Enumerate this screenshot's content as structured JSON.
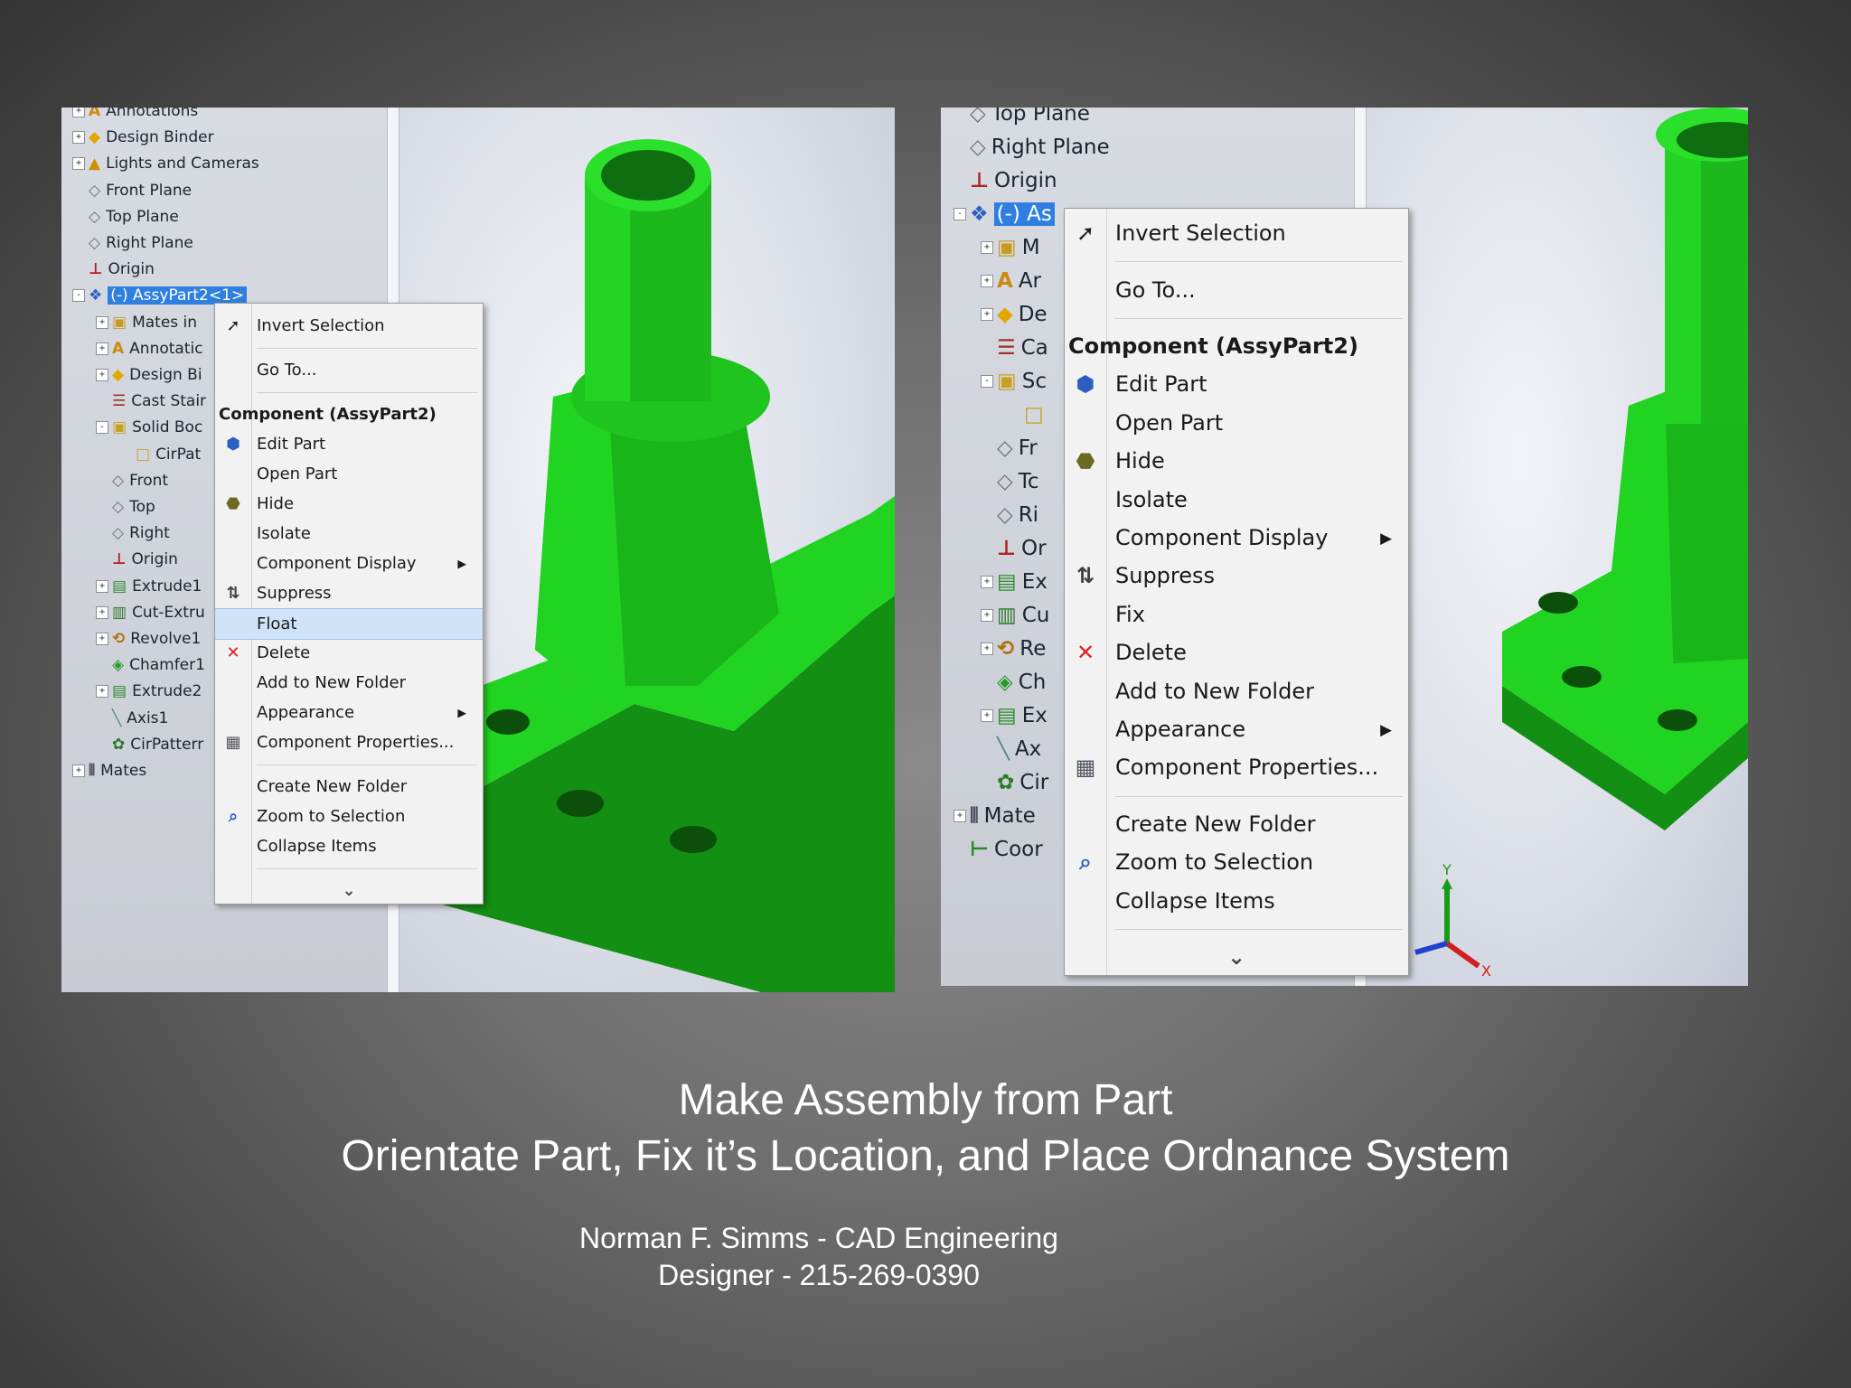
{
  "left_screenshot": {
    "tree": [
      {
        "label": "Annotations",
        "icon": "annotations-icon",
        "exp": "+"
      },
      {
        "label": "Design Binder",
        "icon": "design-binder-icon",
        "exp": "+"
      },
      {
        "label": "Lights and Cameras",
        "icon": "lights-cameras-icon",
        "exp": "+"
      },
      {
        "label": "Front Plane",
        "icon": "plane-icon",
        "exp": ""
      },
      {
        "label": "Top Plane",
        "icon": "plane-icon",
        "exp": ""
      },
      {
        "label": "Right Plane",
        "icon": "plane-icon",
        "exp": ""
      },
      {
        "label": "Origin",
        "icon": "origin-icon",
        "exp": ""
      },
      {
        "label": "(-) AssyPart2<1>",
        "icon": "component-icon",
        "exp": "-",
        "selected": true
      },
      {
        "label": "Mates in",
        "icon": "mates-folder-icon",
        "exp": "+",
        "indent": 1
      },
      {
        "label": "Annotatic",
        "icon": "annotations-icon",
        "exp": "+",
        "indent": 1
      },
      {
        "label": "Design Bi",
        "icon": "design-binder-icon",
        "exp": "+",
        "indent": 1
      },
      {
        "label": "Cast Stair",
        "icon": "cast-stair-icon",
        "exp": "",
        "indent": 1
      },
      {
        "label": "Solid Boc",
        "icon": "solid-bodies-icon",
        "exp": "-",
        "indent": 1
      },
      {
        "label": "CirPat",
        "icon": "body-icon",
        "exp": "",
        "indent": 2
      },
      {
        "label": "Front",
        "icon": "plane-icon",
        "exp": "",
        "indent": 1
      },
      {
        "label": "Top",
        "icon": "plane-icon",
        "exp": "",
        "indent": 1
      },
      {
        "label": "Right",
        "icon": "plane-icon",
        "exp": "",
        "indent": 1
      },
      {
        "label": "Origin",
        "icon": "origin-icon",
        "exp": "",
        "indent": 1
      },
      {
        "label": "Extrude1",
        "icon": "extrude-icon",
        "exp": "+",
        "indent": 1
      },
      {
        "label": "Cut-Extru",
        "icon": "cut-extrude-icon",
        "exp": "+",
        "indent": 1
      },
      {
        "label": "Revolve1",
        "icon": "revolve-icon",
        "exp": "+",
        "indent": 1
      },
      {
        "label": "Chamfer1",
        "icon": "chamfer-icon",
        "exp": "",
        "indent": 1
      },
      {
        "label": "Extrude2",
        "icon": "extrude-icon",
        "exp": "+",
        "indent": 1
      },
      {
        "label": "Axis1",
        "icon": "axis-icon",
        "exp": "",
        "indent": 1
      },
      {
        "label": "CirPatterr",
        "icon": "circular-pattern-icon",
        "exp": "",
        "indent": 1
      },
      {
        "label": "Mates",
        "icon": "mates-icon",
        "exp": "+"
      }
    ],
    "menu": [
      {
        "type": "item",
        "label": "Invert Selection",
        "icon": "invert-selection-icon"
      },
      {
        "type": "sep"
      },
      {
        "type": "item",
        "label": "Go To..."
      },
      {
        "type": "sep"
      },
      {
        "type": "header",
        "label": "Component (AssyPart2)"
      },
      {
        "type": "item",
        "label": "Edit Part",
        "icon": "edit-part-icon"
      },
      {
        "type": "item",
        "label": "Open Part"
      },
      {
        "type": "item",
        "label": "Hide",
        "icon": "hide-icon"
      },
      {
        "type": "item",
        "label": "Isolate"
      },
      {
        "type": "item",
        "label": "Component Display",
        "submenu": true
      },
      {
        "type": "item",
        "label": "Suppress",
        "icon": "suppress-icon"
      },
      {
        "type": "item",
        "label": "Float",
        "highlighted": true
      },
      {
        "type": "item",
        "label": "Delete",
        "icon": "delete-icon"
      },
      {
        "type": "item",
        "label": "Add to New Folder"
      },
      {
        "type": "item",
        "label": "Appearance",
        "submenu": true
      },
      {
        "type": "item",
        "label": "Component Properties...",
        "icon": "component-properties-icon"
      },
      {
        "type": "sep"
      },
      {
        "type": "item",
        "label": "Create New Folder"
      },
      {
        "type": "item",
        "label": "Zoom to Selection",
        "icon": "zoom-to-selection-icon"
      },
      {
        "type": "item",
        "label": "Collapse Items"
      },
      {
        "type": "sep"
      },
      {
        "type": "more",
        "label": "⌄"
      }
    ]
  },
  "right_screenshot": {
    "tree": [
      {
        "label": "Top Plane",
        "icon": "plane-icon",
        "exp": ""
      },
      {
        "label": "Right Plane",
        "icon": "plane-icon",
        "exp": ""
      },
      {
        "label": "Origin",
        "icon": "origin-icon",
        "exp": ""
      },
      {
        "label": "(-) As",
        "icon": "component-icon",
        "exp": "-",
        "selected": true
      },
      {
        "label": "M",
        "icon": "mates-folder-icon",
        "exp": "+",
        "indent": 1
      },
      {
        "label": "Ar",
        "icon": "annotations-icon",
        "exp": "+",
        "indent": 1
      },
      {
        "label": "De",
        "icon": "design-binder-icon",
        "exp": "+",
        "indent": 1
      },
      {
        "label": "Ca",
        "icon": "cast-stair-icon",
        "exp": "",
        "indent": 1
      },
      {
        "label": "Sc",
        "icon": "solid-bodies-icon",
        "exp": "-",
        "indent": 1
      },
      {
        "label": "",
        "icon": "body-icon",
        "exp": "",
        "indent": 2
      },
      {
        "label": "Fr",
        "icon": "plane-icon",
        "exp": "",
        "indent": 1
      },
      {
        "label": "Tc",
        "icon": "plane-icon",
        "exp": "",
        "indent": 1
      },
      {
        "label": "Ri",
        "icon": "plane-icon",
        "exp": "",
        "indent": 1
      },
      {
        "label": "Or",
        "icon": "origin-icon",
        "exp": "",
        "indent": 1
      },
      {
        "label": "Ex",
        "icon": "extrude-icon",
        "exp": "+",
        "indent": 1
      },
      {
        "label": "Cu",
        "icon": "cut-extrude-icon",
        "exp": "+",
        "indent": 1
      },
      {
        "label": "Re",
        "icon": "revolve-icon",
        "exp": "+",
        "indent": 1
      },
      {
        "label": "Ch",
        "icon": "chamfer-icon",
        "exp": "",
        "indent": 1
      },
      {
        "label": "Ex",
        "icon": "extrude-icon",
        "exp": "+",
        "indent": 1
      },
      {
        "label": "Ax",
        "icon": "axis-icon",
        "exp": "",
        "indent": 1
      },
      {
        "label": "Cir",
        "icon": "circular-pattern-icon",
        "exp": "",
        "indent": 1
      },
      {
        "label": "Mate",
        "icon": "mates-icon",
        "exp": "+"
      },
      {
        "label": "Coor",
        "icon": "coordinate-system-icon",
        "exp": ""
      }
    ],
    "menu": [
      {
        "type": "item",
        "label": "Invert Selection",
        "icon": "invert-selection-icon"
      },
      {
        "type": "sep"
      },
      {
        "type": "item",
        "label": "Go To..."
      },
      {
        "type": "sep"
      },
      {
        "type": "header",
        "label": "Component (AssyPart2)"
      },
      {
        "type": "item",
        "label": "Edit Part",
        "icon": "edit-part-icon"
      },
      {
        "type": "item",
        "label": "Open Part"
      },
      {
        "type": "item",
        "label": "Hide",
        "icon": "hide-icon"
      },
      {
        "type": "item",
        "label": "Isolate"
      },
      {
        "type": "item",
        "label": "Component Display",
        "submenu": true
      },
      {
        "type": "item",
        "label": "Suppress",
        "icon": "suppress-icon"
      },
      {
        "type": "item",
        "label": "Fix"
      },
      {
        "type": "item",
        "label": "Delete",
        "icon": "delete-icon"
      },
      {
        "type": "item",
        "label": "Add to New Folder"
      },
      {
        "type": "item",
        "label": "Appearance",
        "submenu": true
      },
      {
        "type": "item",
        "label": "Component Properties...",
        "icon": "component-properties-icon"
      },
      {
        "type": "sep"
      },
      {
        "type": "item",
        "label": "Create New Folder"
      },
      {
        "type": "item",
        "label": "Zoom to Selection",
        "icon": "zoom-to-selection-icon"
      },
      {
        "type": "item",
        "label": "Collapse Items"
      },
      {
        "type": "sep"
      },
      {
        "type": "more",
        "label": "⌄"
      }
    ],
    "triad_labels": {
      "y": "Y",
      "x": "X"
    }
  },
  "slide": {
    "title_line1": "Make Assembly from Part",
    "title_line2": "Orientate Part, Fix it’s Location, and Place Ordnance System",
    "credit_line1": "Norman F. Simms - CAD Engineering",
    "credit_line2": "Designer - 215-269-0390"
  },
  "colors": {
    "part_green": "#22d422",
    "selection_blue": "#2f7fe0",
    "menu_highlight": "#cfe3f8",
    "delete_red": "#e02020"
  }
}
